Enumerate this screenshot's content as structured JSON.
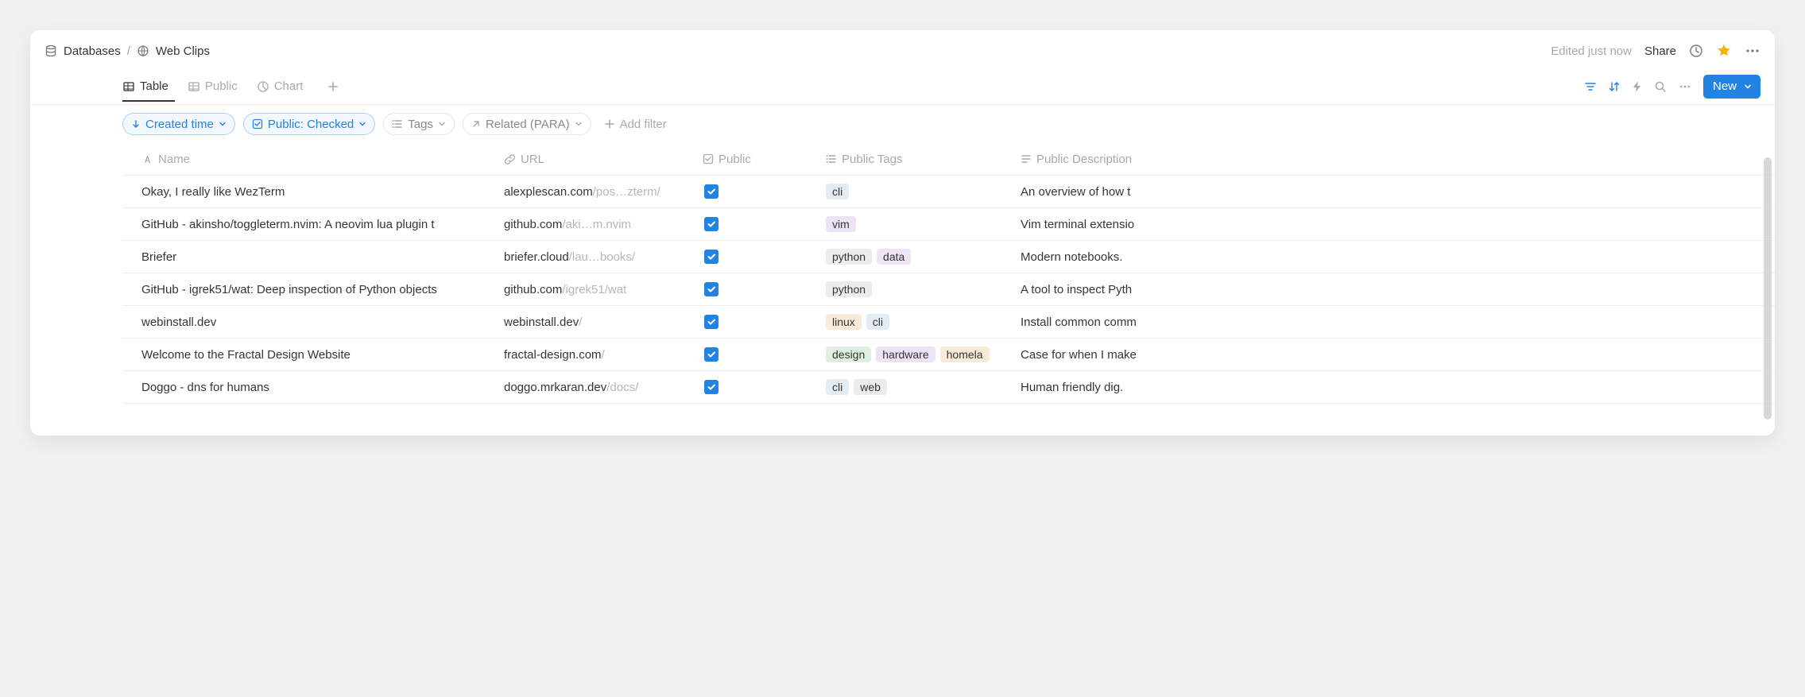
{
  "breadcrumb": {
    "root": "Databases",
    "page": "Web Clips"
  },
  "header": {
    "edited_status": "Edited just now",
    "share_label": "Share"
  },
  "views": {
    "tabs": [
      {
        "label": "Table",
        "active": true
      },
      {
        "label": "Public",
        "active": false
      },
      {
        "label": "Chart",
        "active": false
      }
    ],
    "new_label": "New"
  },
  "filters": {
    "sort_label": "Created time",
    "public_filter_label": "Public: Checked",
    "tags_label": "Tags",
    "related_label": "Related (PARA)",
    "add_filter_label": "Add filter"
  },
  "columns": {
    "name": "Name",
    "url": "URL",
    "public": "Public",
    "public_tags": "Public Tags",
    "public_description": "Public Description"
  },
  "rows": [
    {
      "name": "Okay, I really like WezTerm",
      "url_main": "alexplescan.com",
      "url_faded": "/pos…zterm/",
      "public": true,
      "tags": [
        {
          "text": "cli",
          "cls": "tag-cli"
        }
      ],
      "description": "An overview of how t"
    },
    {
      "name": "GitHub - akinsho/toggleterm.nvim: A neovim lua plugin t",
      "url_main": "github.com",
      "url_faded": "/aki…m.nvim",
      "public": true,
      "tags": [
        {
          "text": "vim",
          "cls": "tag-vim"
        }
      ],
      "description": "Vim terminal extensio"
    },
    {
      "name": "Briefer",
      "url_main": "briefer.cloud",
      "url_faded": "/lau…books/",
      "public": true,
      "tags": [
        {
          "text": "python",
          "cls": "tag-python"
        },
        {
          "text": "data",
          "cls": "tag-data"
        }
      ],
      "description": "Modern notebooks."
    },
    {
      "name": "GitHub - igrek51/wat: Deep inspection of Python objects",
      "url_main": "github.com",
      "url_faded": "/igrek51/wat",
      "public": true,
      "tags": [
        {
          "text": "python",
          "cls": "tag-python"
        }
      ],
      "description": "A tool to inspect Pyth"
    },
    {
      "name": "webinstall.dev",
      "url_main": "webinstall.dev",
      "url_faded": "/",
      "public": true,
      "tags": [
        {
          "text": "linux",
          "cls": "tag-linux"
        },
        {
          "text": "cli",
          "cls": "tag-cli"
        }
      ],
      "description": "Install common comm"
    },
    {
      "name": "Welcome to the Fractal Design Website",
      "url_main": "fractal-design.com",
      "url_faded": "/",
      "public": true,
      "tags": [
        {
          "text": "design",
          "cls": "tag-design"
        },
        {
          "text": "hardware",
          "cls": "tag-hardware"
        },
        {
          "text": "homela",
          "cls": "tag-homelab"
        }
      ],
      "description": "Case for when I make"
    },
    {
      "name": "Doggo - dns for humans",
      "url_main": "doggo.mrkaran.dev",
      "url_faded": "/docs/",
      "public": true,
      "tags": [
        {
          "text": "cli",
          "cls": "tag-cli"
        },
        {
          "text": "web",
          "cls": "tag-web"
        }
      ],
      "description": "Human friendly dig."
    }
  ]
}
